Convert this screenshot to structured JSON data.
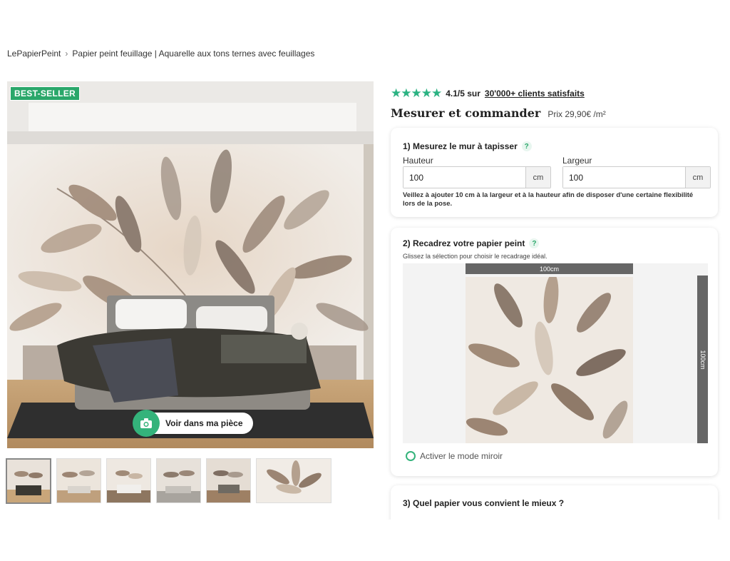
{
  "breadcrumb": {
    "home": "LePapierPeint",
    "separator": "›",
    "current": "Papier peint feuillage | Aquarelle aux tons ternes avec feuillages"
  },
  "hero": {
    "badge": "BEST-SELLER",
    "room_button": "Voir dans ma pièce",
    "room_icon": "camera-icon"
  },
  "thumbnails": [
    "thumb-1",
    "thumb-2",
    "thumb-3",
    "thumb-4",
    "thumb-5",
    "thumb-6"
  ],
  "rating": {
    "stars": "★★★★★",
    "value": "4.1/5 sur",
    "link": "30'000+ clients satisfaits",
    "star_color": "#2bb383"
  },
  "order": {
    "title": "Mesurer et commander",
    "price": "Prix 29,90€ /m²"
  },
  "step1": {
    "title": "1) Mesurez le mur à tapisser",
    "help": "?",
    "height_label": "Hauteur",
    "height_value": "100",
    "width_label": "Largeur",
    "width_value": "100",
    "unit": "cm",
    "note": "Veillez à ajouter 10 cm à la largeur et à la hauteur afin de disposer d'une certaine flexibilité lors de la pose."
  },
  "step2": {
    "title": "2) Recadrez votre papier peint",
    "help": "?",
    "subtitle": "Glissez la sélection pour choisir le recadrage idéal.",
    "width_ruler": "100cm",
    "height_ruler": "100cm",
    "mirror_label": "Activer le mode miroir"
  },
  "step3": {
    "title": "3) Quel papier vous convient le mieux ?"
  },
  "colors": {
    "accent": "#2aa76a",
    "ruler": "#666666"
  }
}
